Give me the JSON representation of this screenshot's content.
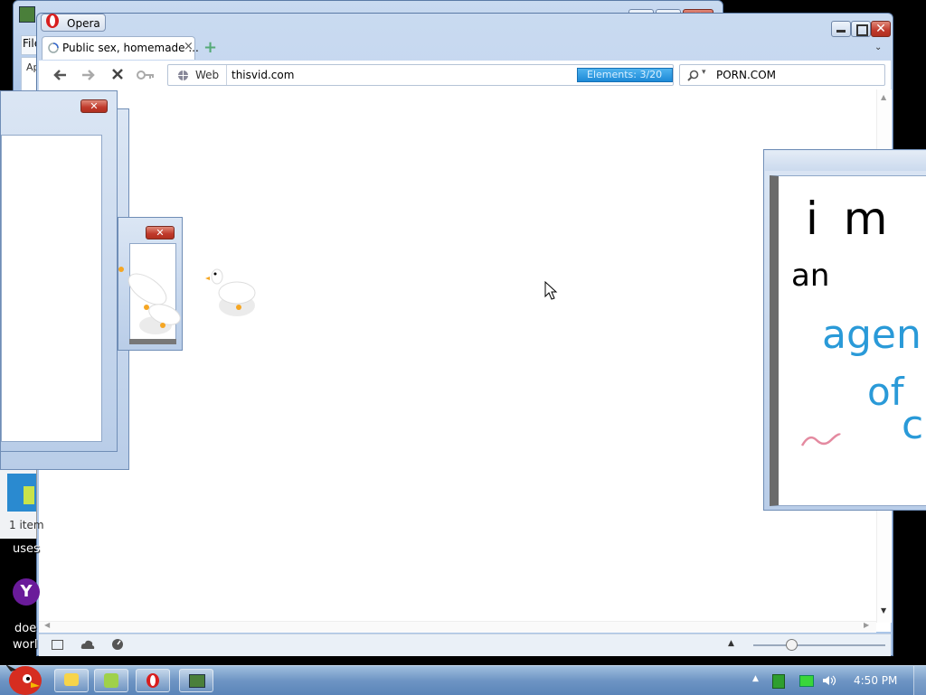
{
  "back_window": {
    "menu_file": "File"
  },
  "browser": {
    "app_title": "Opera",
    "tab_title": "Public sex, homemade ...",
    "new_tab_symbol": "+",
    "web_label": "Web",
    "url": "thisvid.com",
    "elements_counter": "Elements:  3/20",
    "search_value": "PORN.COM"
  },
  "drawing": {
    "line1": "i m",
    "line2": "an",
    "line3": "agen",
    "line4": "of",
    "line5": "c"
  },
  "desktop": {
    "items_label": "1 item",
    "text_uses": "uses",
    "text_does": "doe",
    "text_world": "worl"
  },
  "taskbar": {
    "clock": "4:50 PM"
  },
  "colors": {
    "accent_blue": "#1d8ad7",
    "drawing_blue": "#2a9ad8",
    "drawing_pink": "#e48aa0",
    "close_red": "#c0392b"
  },
  "icons": [
    "back-arrow-icon",
    "forward-arrow-icon",
    "stop-icon",
    "key-icon",
    "globe-icon",
    "search-icon",
    "chevron-down-icon",
    "minimize-icon",
    "maximize-icon",
    "close-icon",
    "opera-logo-icon",
    "angry-bird-icon",
    "explorer-icon",
    "mail-icon",
    "volume-icon",
    "network-icon",
    "goose-icon",
    "cursor-icon"
  ]
}
